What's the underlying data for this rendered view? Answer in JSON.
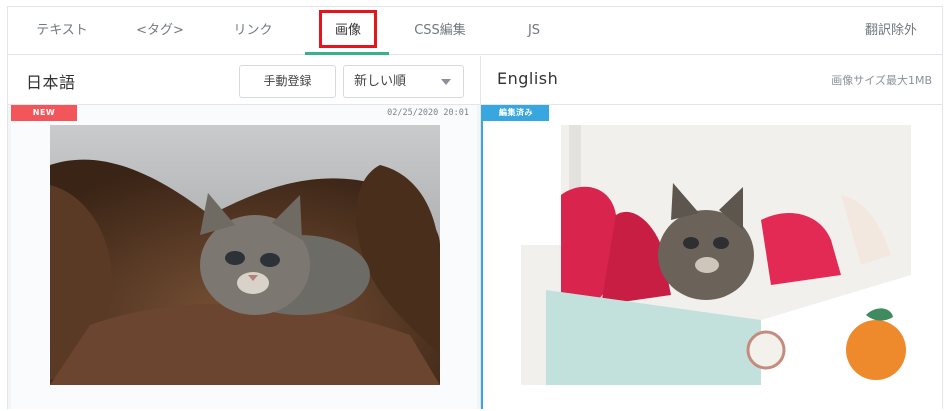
{
  "tabs": [
    {
      "label": "テキスト"
    },
    {
      "label": "<タグ>"
    },
    {
      "label": "リンク"
    },
    {
      "label": "画像"
    },
    {
      "label": "CSS編集"
    },
    {
      "label": "JS"
    },
    {
      "label": "翻訳除外"
    }
  ],
  "active_tab": "画像",
  "left_pane": {
    "title": "日本語",
    "manual_button": "手動登録",
    "sort_select": "新しい順",
    "badge": "NEW",
    "timestamp": "02/25/2020 20:01"
  },
  "right_pane": {
    "title": "English",
    "size_note": "画像サイズ最大1MB",
    "badge": "編集済み"
  },
  "colors": {
    "accent": "#3bb08f",
    "new_badge": "#f2555a",
    "edited_badge": "#39a7df",
    "highlight": "#e8141c"
  }
}
